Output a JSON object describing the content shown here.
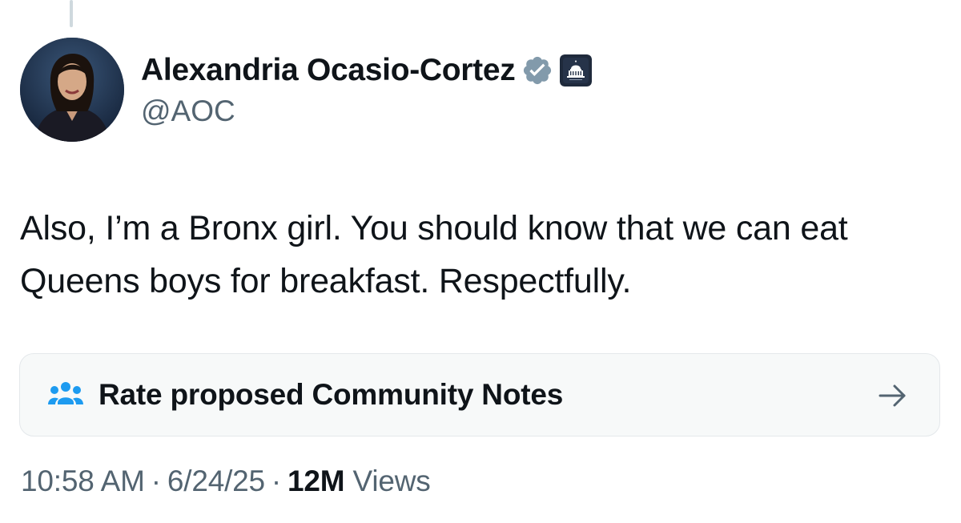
{
  "author": {
    "display_name": "Alexandria Ocasio-Cortez",
    "handle": "@AOC",
    "verified": true,
    "verified_color": "#829aab",
    "affiliation_badge": "us-capitol-icon"
  },
  "tweet": {
    "text": "Also, I’m a Bronx girl. You should know that we can eat Queens boys for breakfast. Respectfully."
  },
  "community_notes": {
    "label": "Rate proposed Community Notes",
    "icon": "people-icon",
    "icon_color": "#1d9bf0",
    "action_icon": "arrow-right-icon"
  },
  "meta": {
    "time": "10:58 AM",
    "date": "6/24/25",
    "separator": "·",
    "views_count": "12M",
    "views_label": "Views"
  }
}
